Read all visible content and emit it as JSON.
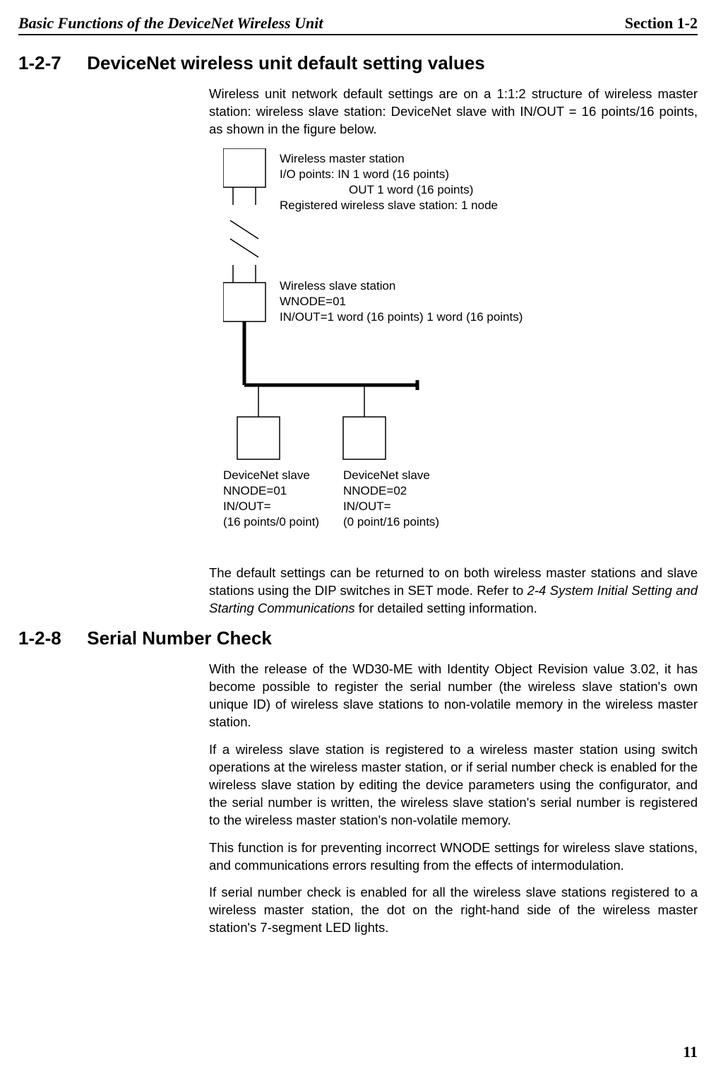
{
  "header": {
    "left": "Basic Functions of the DeviceNet Wireless Unit",
    "right": "Section 1-2"
  },
  "section_1_2_7": {
    "number": "1-2-7",
    "title": "DeviceNet wireless unit default setting values",
    "intro": "Wireless unit network default settings are on a 1:1:2 structure of wireless master station: wireless slave station: DeviceNet slave with IN/OUT = 16 points/16 points, as shown in the figure below.",
    "outro_a": "The default settings can be returned to on both wireless master stations and slave stations using the DIP switches in SET mode. Refer to ",
    "outro_ref": "2-4 System Initial Setting and Starting Communications",
    "outro_b": " for detailed setting information."
  },
  "diagram": {
    "master": {
      "l1": "Wireless master station",
      "l2": "I/O points:    IN 1 word (16 points)",
      "l3": "OUT 1 word (16 points)",
      "l4": "Registered wireless slave station: 1 node"
    },
    "slave_station": {
      "l1": "Wireless slave station",
      "l2": "WNODE=01",
      "l3": "IN/OUT=1 word (16 points) 1 word (16 points)"
    },
    "devnet1": {
      "l1": "DeviceNet slave",
      "l2": "NNODE=01",
      "l3": "IN/OUT=",
      "l4": "(16 points/0 point)"
    },
    "devnet2": {
      "l1": "DeviceNet slave",
      "l2": "NNODE=02",
      "l3": "IN/OUT=",
      "l4": "(0 point/16 points)"
    }
  },
  "section_1_2_8": {
    "number": "1-2-8",
    "title": "Serial Number Check",
    "p1": "With the release of the WD30-ME with Identity Object Revision value 3.02, it has become possible to register the serial number (the wireless slave station's own unique ID) of wireless slave stations to non-volatile memory in the wireless master station.",
    "p2": "If a wireless slave station is registered to a wireless master station using switch operations at the wireless master station, or if serial number check is enabled for the wireless slave station by editing the device parameters using the configurator, and the serial number is written, the wireless slave station's serial number is registered to the wireless master station's non-volatile memory.",
    "p3": "This function is for preventing incorrect WNODE settings for wireless slave stations, and communications errors resulting from the effects of intermodulation.",
    "p4": "If serial number check is enabled for all the wireless slave stations registered to a wireless master station, the dot on the right-hand side of the wireless master station's 7-segment LED lights."
  },
  "page_number": "11"
}
